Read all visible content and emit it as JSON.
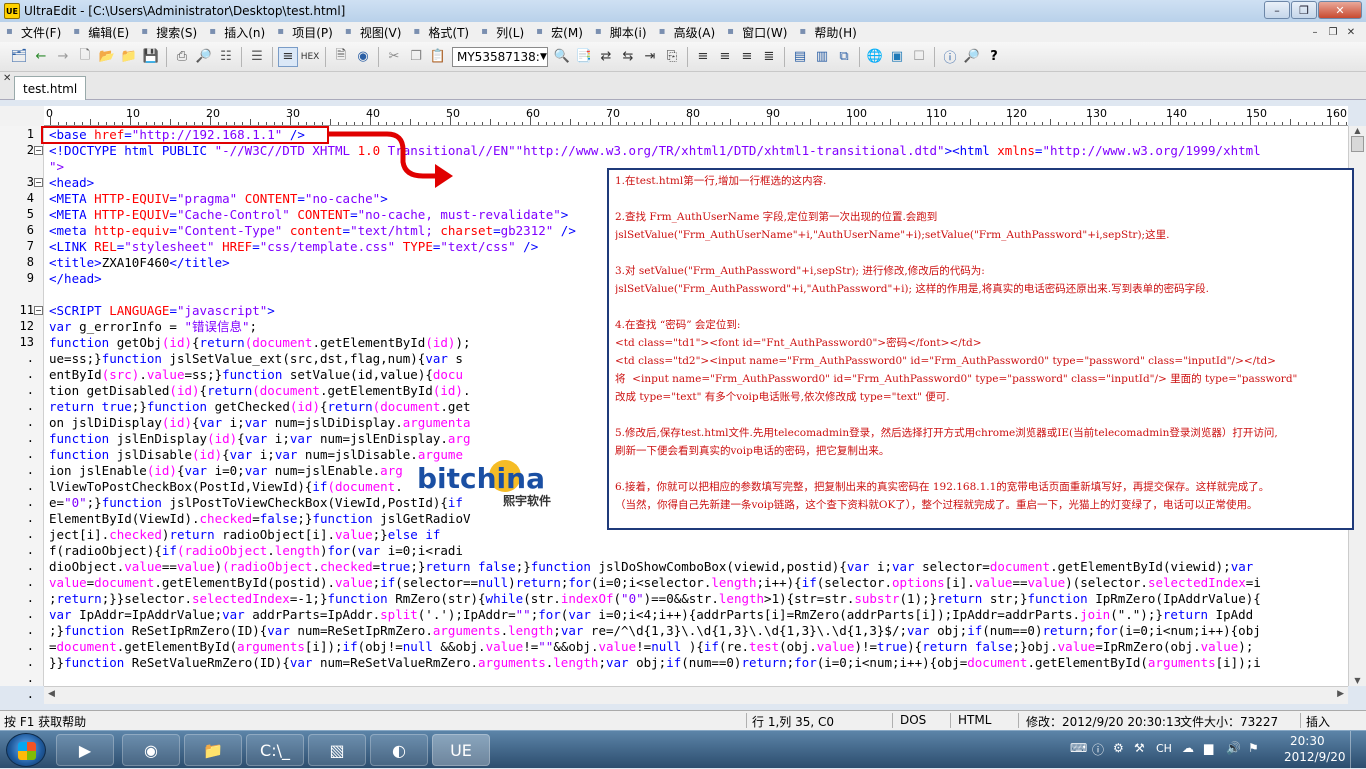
{
  "window": {
    "title": "UltraEdit - [C:\\Users\\Administrator\\Desktop\\test.html]",
    "buttons": [
      "minimize",
      "maximize",
      "close"
    ]
  },
  "menu": [
    "文件(F)",
    "编辑(E)",
    "搜索(S)",
    "插入(n)",
    "项目(P)",
    "视图(V)",
    "格式(T)",
    "列(L)",
    "宏(M)",
    "脚本(i)",
    "高级(A)",
    "窗口(W)",
    "帮助(H)"
  ],
  "toolbar": {
    "combo_value": "MY53587138:"
  },
  "tab": {
    "label": "test.html"
  },
  "ruler_labels": [
    "0",
    "10",
    "20",
    "30",
    "40",
    "50",
    "60",
    "70",
    "80",
    "90",
    "100",
    "110",
    "120",
    "130",
    "140",
    "150",
    "160"
  ],
  "gutter": {
    "numbers": [
      "1",
      "2",
      "",
      "3",
      "4",
      "5",
      "6",
      "7",
      "8",
      "9",
      "",
      "11",
      "12",
      "13",
      ".",
      ".",
      ".",
      ".",
      ".",
      ".",
      ".",
      ".",
      ".",
      ".",
      ".",
      ".",
      ".",
      ".",
      ".",
      ".",
      ".",
      ".",
      ".",
      ".",
      ".",
      ".",
      "."
    ]
  },
  "status": {
    "help": "按 F1 获取帮助",
    "position": "行 1,列 35, C0",
    "encoding": "DOS",
    "syntax": "HTML",
    "modified": "修改：2012/9/20 20:30:13",
    "filesize": "文件大小：73227",
    "mode": "插入"
  },
  "taskbar": {
    "time": "20:30",
    "date": "2012/9/20",
    "ime": "CH"
  },
  "watermark": {
    "brand": "bitchina",
    "sub": "熙宇软件"
  },
  "annotation": [
    "1.在test.html第一行,增加一行框选的这内容.",
    "",
    "2.查找 Frm_AuthUserName 字段,定位到第一次出现的位置.会跑到",
    "jslSetValue(\"Frm_AuthUserName\"+i,\"AuthUserName\"+i);setValue(\"Frm_AuthPassword\"+i,sepStr);这里.",
    "",
    "3.对 setValue(\"Frm_AuthPassword\"+i,sepStr); 进行修改,修改后的代码为:",
    "jslSetValue(\"Frm_AuthPassword\"+i,\"AuthPassword\"+i); 这样的作用是,将真实的电话密码还原出来.写到表单的密码字段.",
    "",
    "4.在查找 “密码” 会定位到:",
    "<td class=\"td1\"><font id=\"Fnt_AuthPassword0\">密码</font></td>",
    "<td class=\"td2\"><input name=\"Frm_AuthPassword0\" id=\"Frm_AuthPassword0\" type=\"password\" class=\"inputId\"/></td>",
    "将  <input name=\"Frm_AuthPassword0\" id=\"Frm_AuthPassword0\" type=\"password\" class=\"inputId\"/> 里面的 type=\"password\"",
    "改成 type=\"text\" 有多个voip电话账号,依次修改成 type=\"text\" 便可.",
    "",
    "5.修改后,保存test.html文件.先用telecomadmin登录，然后选择打开方式用chrome浏览器或IE(当前telecomadmin登录浏览器）打开访问,",
    "刷新一下便会看到真实的voip电话的密码，把它复制出来。",
    "",
    "6.接着，你就可以把相应的参数填写完整，把复制出来的真实密码在 192.168.1.1的宽带电话页面重新填写好，再提交保存。这样就完成了。",
    "（当然，你得自己先新建一条voip链路，这个查下资料就OK了），整个过程就完成了。重启一下，光猫上的灯变绿了，电话可以正常使用。"
  ],
  "code_lines": [
    [
      [
        "t",
        "<base "
      ],
      [
        "a",
        "href"
      ],
      [
        "t",
        "="
      ],
      [
        "s",
        "\"http://192.168.1.1\""
      ],
      [
        "t",
        " />"
      ]
    ],
    [
      [
        "t",
        "<!DOCTYPE html PUBLIC "
      ],
      [
        "s",
        "\"-//W3C//DTD XHTML "
      ],
      [
        "n",
        "1.0"
      ],
      [
        "s",
        " Transitional//EN\"\"http://www.w3.org/TR/xhtml1/DTD/xhtml1-transitional.dtd\""
      ],
      [
        "t",
        ">"
      ],
      [
        "t",
        "<html "
      ],
      [
        "a",
        "xmlns"
      ],
      [
        "t",
        "="
      ],
      [
        "s",
        "\"http://www.w3.org/1999/xhtml"
      ]
    ],
    [
      [
        "s",
        "\">"
      ]
    ],
    [
      [
        "t",
        "<head>"
      ]
    ],
    [
      [
        "t",
        "<META "
      ],
      [
        "a",
        "HTTP-EQUIV"
      ],
      [
        "t",
        "="
      ],
      [
        "s",
        "\"pragma\""
      ],
      [
        "t",
        " "
      ],
      [
        "a",
        "CONTENT"
      ],
      [
        "t",
        "="
      ],
      [
        "s",
        "\"no-cache\""
      ],
      [
        "t",
        ">"
      ]
    ],
    [
      [
        "t",
        "<META "
      ],
      [
        "a",
        "HTTP-EQUIV"
      ],
      [
        "t",
        "="
      ],
      [
        "s",
        "\"Cache-Control\""
      ],
      [
        "t",
        " "
      ],
      [
        "a",
        "CONTENT"
      ],
      [
        "t",
        "="
      ],
      [
        "s",
        "\"no-cache, must-revalidate\""
      ],
      [
        "t",
        ">"
      ]
    ],
    [
      [
        "t",
        "<meta "
      ],
      [
        "a",
        "http-equiv"
      ],
      [
        "t",
        "="
      ],
      [
        "s",
        "\"Content-Type\""
      ],
      [
        "t",
        " "
      ],
      [
        "a",
        "content"
      ],
      [
        "t",
        "="
      ],
      [
        "s",
        "\"text/html; "
      ],
      [
        "a",
        "charset"
      ],
      [
        "t",
        "="
      ],
      [
        "s",
        "gb2312\""
      ],
      [
        "t",
        " />"
      ]
    ],
    [
      [
        "t",
        "<LINK "
      ],
      [
        "a",
        "REL"
      ],
      [
        "t",
        "="
      ],
      [
        "s",
        "\"stylesheet\""
      ],
      [
        "t",
        " "
      ],
      [
        "a",
        "HREF"
      ],
      [
        "t",
        "="
      ],
      [
        "s",
        "\"css/template.css\""
      ],
      [
        "t",
        " "
      ],
      [
        "a",
        "TYPE"
      ],
      [
        "t",
        "="
      ],
      [
        "s",
        "\"text/css\""
      ],
      [
        "t",
        " />"
      ]
    ],
    [
      [
        "t",
        "<title>"
      ],
      [
        "x",
        "ZXA10F460"
      ],
      [
        "t",
        "</title>"
      ]
    ],
    [
      [
        "t",
        "</head>"
      ]
    ],
    [
      [
        "x",
        ""
      ]
    ],
    [
      [
        "t",
        "<SCRIPT "
      ],
      [
        "a",
        "LANGUAGE"
      ],
      [
        "t",
        "="
      ],
      [
        "s",
        "\"javascript\""
      ],
      [
        "t",
        ">"
      ]
    ],
    [
      [
        "k",
        "var"
      ],
      [
        "x",
        " g_errorInfo = "
      ],
      [
        "s",
        "\"错误信息\""
      ],
      [
        "x",
        ";"
      ]
    ],
    [
      [
        "k",
        "function"
      ],
      [
        "x",
        " getObj"
      ],
      [
        "f",
        "(id)"
      ],
      [
        "x",
        "{"
      ],
      [
        "k",
        "return"
      ],
      [
        "f",
        "(document"
      ],
      [
        "x",
        ".getElementById"
      ],
      [
        "f",
        "(id)"
      ],
      [
        "x",
        ");"
      ]
    ],
    [
      [
        "x",
        "ue=ss;}"
      ],
      [
        "k",
        "function"
      ],
      [
        "x",
        " jslSetValue_ext(src,dst,flag,num){"
      ],
      [
        "k",
        "var"
      ],
      [
        "x",
        " s"
      ]
    ],
    [
      [
        "x",
        "entById"
      ],
      [
        "f",
        "(src)"
      ],
      [
        "x",
        "."
      ],
      [
        "f",
        "value"
      ],
      [
        "x",
        "=ss;}"
      ],
      [
        "k",
        "function"
      ],
      [
        "x",
        " setValue(id,value){"
      ],
      [
        "f",
        "docu"
      ]
    ],
    [
      [
        "x",
        "tion getDisabled"
      ],
      [
        "f",
        "(id)"
      ],
      [
        "x",
        "{"
      ],
      [
        "k",
        "return"
      ],
      [
        "f",
        "(document"
      ],
      [
        "x",
        ".getElementById"
      ],
      [
        "f",
        "(id)"
      ],
      [
        "x",
        "."
      ]
    ],
    [
      [
        "k",
        "return true"
      ],
      [
        "x",
        ";}"
      ],
      [
        "k",
        "function"
      ],
      [
        "x",
        " getChecked"
      ],
      [
        "f",
        "(id)"
      ],
      [
        "x",
        "{"
      ],
      [
        "k",
        "return"
      ],
      [
        "f",
        "(document"
      ],
      [
        "x",
        ".get"
      ]
    ],
    [
      [
        "x",
        "on jslDiDisplay"
      ],
      [
        "f",
        "(id)"
      ],
      [
        "x",
        "{"
      ],
      [
        "k",
        "var"
      ],
      [
        "x",
        " i;"
      ],
      [
        "k",
        "var"
      ],
      [
        "x",
        " num=jslDiDisplay."
      ],
      [
        "f",
        "argumenta"
      ]
    ],
    [
      [
        "k",
        "function"
      ],
      [
        "x",
        " jslEnDisplay"
      ],
      [
        "f",
        "(id)"
      ],
      [
        "x",
        "{"
      ],
      [
        "k",
        "var"
      ],
      [
        "x",
        " i;"
      ],
      [
        "k",
        "var"
      ],
      [
        "x",
        " num=jslEnDisplay."
      ],
      [
        "f",
        "arg"
      ]
    ],
    [
      [
        "k",
        "function"
      ],
      [
        "x",
        " jslDisable"
      ],
      [
        "f",
        "(id)"
      ],
      [
        "x",
        "{"
      ],
      [
        "k",
        "var"
      ],
      [
        "x",
        " i;"
      ],
      [
        "k",
        "var"
      ],
      [
        "x",
        " num=jslDisable."
      ],
      [
        "f",
        "argume"
      ]
    ],
    [
      [
        "x",
        "ion jslEnable"
      ],
      [
        "f",
        "(id)"
      ],
      [
        "x",
        "{"
      ],
      [
        "k",
        "var"
      ],
      [
        "x",
        " i=0;"
      ],
      [
        "k",
        "var"
      ],
      [
        "x",
        " num=jslEnable."
      ],
      [
        "f",
        "arg"
      ]
    ],
    [
      [
        "x",
        "lViewToPostCheckBox(PostId,ViewId){"
      ],
      [
        "k",
        "if"
      ],
      [
        "f",
        "(document"
      ],
      [
        "x",
        "."
      ]
    ],
    [
      [
        "x",
        "e="
      ],
      [
        "s",
        "\"0\""
      ],
      [
        "x",
        ";}"
      ],
      [
        "k",
        "function"
      ],
      [
        "x",
        " jslPostToViewCheckBox(ViewId,PostId){"
      ],
      [
        "k",
        "if"
      ]
    ],
    [
      [
        "x",
        "ElementById(ViewId)."
      ],
      [
        "f",
        "checked"
      ],
      [
        "x",
        "="
      ],
      [
        "k",
        "false"
      ],
      [
        "x",
        ";}"
      ],
      [
        "k",
        "function"
      ],
      [
        "x",
        " jslGetRadioV"
      ]
    ],
    [
      [
        "x",
        "ject[i]."
      ],
      [
        "f",
        "checked"
      ],
      [
        "x",
        ")"
      ],
      [
        "k",
        "return"
      ],
      [
        "x",
        " radioObject[i]."
      ],
      [
        "f",
        "value"
      ],
      [
        "x",
        ";}"
      ],
      [
        "k",
        "else if"
      ]
    ],
    [
      [
        "x",
        "f(radioObject){"
      ],
      [
        "k",
        "if"
      ],
      [
        "f",
        "(radioObject"
      ],
      [
        "x",
        "."
      ],
      [
        "f",
        "length"
      ],
      [
        "x",
        ")"
      ],
      [
        "k",
        "for"
      ],
      [
        "x",
        "("
      ],
      [
        "k",
        "var"
      ],
      [
        "x",
        " i=0;i<radi"
      ]
    ],
    [
      [
        "x",
        "dioObject."
      ],
      [
        "f",
        "value"
      ],
      [
        "x",
        "=="
      ],
      [
        "f",
        "value"
      ],
      [
        "x",
        ")"
      ],
      [
        "f",
        "(radioObject"
      ],
      [
        "x",
        "."
      ],
      [
        "f",
        "checked"
      ],
      [
        "x",
        "="
      ],
      [
        "k",
        "true"
      ],
      [
        "x",
        ";}"
      ],
      [
        "k",
        "return false"
      ],
      [
        "x",
        ";}"
      ],
      [
        "k",
        "function"
      ],
      [
        "x",
        " jslDoShowComboBox(viewid,postid){"
      ],
      [
        "k",
        "var"
      ],
      [
        "x",
        " i;"
      ],
      [
        "k",
        "var"
      ],
      [
        "x",
        " selector="
      ],
      [
        "f",
        "document"
      ],
      [
        "x",
        ".getElementById(viewid);"
      ],
      [
        "k",
        "var"
      ]
    ],
    [
      [
        "f",
        "value"
      ],
      [
        "x",
        "="
      ],
      [
        "f",
        "document"
      ],
      [
        "x",
        ".getElementById(postid)."
      ],
      [
        "f",
        "value"
      ],
      [
        "x",
        ";"
      ],
      [
        "k",
        "if"
      ],
      [
        "x",
        "(selector=="
      ],
      [
        "k",
        "null"
      ],
      [
        "x",
        ")"
      ],
      [
        "k",
        "return"
      ],
      [
        "x",
        ";"
      ],
      [
        "k",
        "for"
      ],
      [
        "x",
        "(i=0;i<selector."
      ],
      [
        "f",
        "length"
      ],
      [
        "x",
        ";i++){"
      ],
      [
        "k",
        "if"
      ],
      [
        "x",
        "(selector."
      ],
      [
        "f",
        "options"
      ],
      [
        "x",
        "[i]."
      ],
      [
        "f",
        "value"
      ],
      [
        "x",
        "=="
      ],
      [
        "f",
        "value"
      ],
      [
        "x",
        ")(selector."
      ],
      [
        "f",
        "selectedIndex"
      ],
      [
        "x",
        "=i"
      ]
    ],
    [
      [
        "x",
        ";"
      ],
      [
        "k",
        "return"
      ],
      [
        "x",
        ";}}selector."
      ],
      [
        "f",
        "selectedIndex"
      ],
      [
        "x",
        "=-1;}"
      ],
      [
        "k",
        "function"
      ],
      [
        "x",
        " RmZero(str){"
      ],
      [
        "k",
        "while"
      ],
      [
        "x",
        "(str."
      ],
      [
        "f",
        "indexOf"
      ],
      [
        "x",
        "("
      ],
      [
        "s",
        "\"0\""
      ],
      [
        "x",
        ")==0&&str."
      ],
      [
        "f",
        "length"
      ],
      [
        "x",
        ">1){str=str."
      ],
      [
        "f",
        "substr"
      ],
      [
        "x",
        "(1);}"
      ],
      [
        "k",
        "return"
      ],
      [
        "x",
        " str;}"
      ],
      [
        "k",
        "function"
      ],
      [
        "x",
        " IpRmZero(IpAddrValue){"
      ]
    ],
    [
      [
        "k",
        "var"
      ],
      [
        "x",
        " IpAddr=IpAddrValue;"
      ],
      [
        "k",
        "var"
      ],
      [
        "x",
        " addrParts=IpAddr."
      ],
      [
        "f",
        "split"
      ],
      [
        "x",
        "('.');IpAddr="
      ],
      [
        "s",
        "\"\""
      ],
      [
        "x",
        ";"
      ],
      [
        "k",
        "for"
      ],
      [
        "x",
        "("
      ],
      [
        "k",
        "var"
      ],
      [
        "x",
        " i=0;i<4;i++){addrParts[i]=RmZero(addrParts[i]);IpAddr=addrParts."
      ],
      [
        "f",
        "join"
      ],
      [
        "x",
        "(\".\");}"
      ],
      [
        "k",
        "return"
      ],
      [
        "x",
        " IpAdd"
      ]
    ],
    [
      [
        "x",
        ";}"
      ],
      [
        "k",
        "function"
      ],
      [
        "x",
        " ReSetIpRmZero(ID){"
      ],
      [
        "k",
        "var"
      ],
      [
        "x",
        " num=ReSetIpRmZero."
      ],
      [
        "f",
        "arguments"
      ],
      [
        "x",
        "."
      ],
      [
        "f",
        "length"
      ],
      [
        "x",
        ";"
      ],
      [
        "k",
        "var"
      ],
      [
        "x",
        " re=/^\\d{1,3}\\.\\d{1,3}\\.\\d{1,3}\\.\\d{1,3}$/;"
      ],
      [
        "k",
        "var"
      ],
      [
        "x",
        " obj;"
      ],
      [
        "k",
        "if"
      ],
      [
        "x",
        "(num==0)"
      ],
      [
        "k",
        "return"
      ],
      [
        "x",
        ";"
      ],
      [
        "k",
        "for"
      ],
      [
        "x",
        "(i=0;i<num;i++){obj"
      ]
    ],
    [
      [
        "x",
        "="
      ],
      [
        "f",
        "document"
      ],
      [
        "x",
        ".getElementById("
      ],
      [
        "f",
        "arguments"
      ],
      [
        "x",
        "[i]);"
      ],
      [
        "k",
        "if"
      ],
      [
        "x",
        "(obj!="
      ],
      [
        "k",
        "null"
      ],
      [
        "x",
        " &&obj."
      ],
      [
        "f",
        "value"
      ],
      [
        "x",
        "!="
      ],
      [
        "s",
        "\"\""
      ],
      [
        "x",
        "&&obj."
      ],
      [
        "f",
        "value"
      ],
      [
        "x",
        "!="
      ],
      [
        "k",
        "null"
      ],
      [
        "x",
        " ){"
      ],
      [
        "k",
        "if"
      ],
      [
        "x",
        "(re."
      ],
      [
        "f",
        "test"
      ],
      [
        "x",
        "(obj."
      ],
      [
        "f",
        "value"
      ],
      [
        "x",
        ")!="
      ],
      [
        "k",
        "true"
      ],
      [
        "x",
        "){"
      ],
      [
        "k",
        "return false"
      ],
      [
        "x",
        ";}obj."
      ],
      [
        "f",
        "value"
      ],
      [
        "x",
        "=IpRmZero(obj."
      ],
      [
        "f",
        "value"
      ],
      [
        "x",
        ");"
      ]
    ],
    [
      [
        "x",
        "}}"
      ],
      [
        "k",
        "function"
      ],
      [
        "x",
        " ReSetValueRmZero(ID){"
      ],
      [
        "k",
        "var"
      ],
      [
        "x",
        " num=ReSetValueRmZero."
      ],
      [
        "f",
        "arguments"
      ],
      [
        "x",
        "."
      ],
      [
        "f",
        "length"
      ],
      [
        "x",
        ";"
      ],
      [
        "k",
        "var"
      ],
      [
        "x",
        " obj;"
      ],
      [
        "k",
        "if"
      ],
      [
        "x",
        "(num==0)"
      ],
      [
        "k",
        "return"
      ],
      [
        "x",
        ";"
      ],
      [
        "k",
        "for"
      ],
      [
        "x",
        "(i=0;i<num;i++){obj="
      ],
      [
        "f",
        "document"
      ],
      [
        "x",
        ".getElementById("
      ],
      [
        "f",
        "arguments"
      ],
      [
        "x",
        "[i]);i"
      ]
    ]
  ]
}
